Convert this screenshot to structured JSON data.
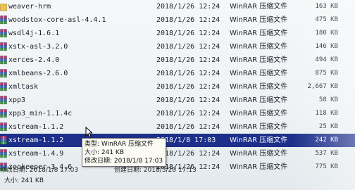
{
  "colors": {
    "selection": "#1c2f8a",
    "tooltip_bg": "#fbfbf4"
  },
  "files": [
    {
      "name": "weaver-hrm",
      "date": "2018/1/26 12:24",
      "type": "WinRAR 压缩文件",
      "size": "163 KB",
      "icon": "folder-icon"
    },
    {
      "name": "woodstox-core-asl-4.4.1",
      "date": "2018/1/26 12:24",
      "type": "WinRAR 压缩文件",
      "size": "475 KB",
      "icon": "winrar-archive-icon"
    },
    {
      "name": "wsdl4j-1.6.1",
      "date": "2018/1/26 12:24",
      "type": "WinRAR 压缩文件",
      "size": "180 KB",
      "icon": "winrar-archive-icon"
    },
    {
      "name": "xstx-asl-3.2.0",
      "date": "2018/1/26 12:24",
      "type": "WinRAR 压缩文件",
      "size": "146 KB",
      "icon": "winrar-archive-icon"
    },
    {
      "name": "xerces-2.4.0",
      "date": "2018/1/26 12:24",
      "type": "WinRAR 压缩文件",
      "size": "494 KB",
      "icon": "winrar-archive-icon"
    },
    {
      "name": "xmlbeans-2.6.0",
      "date": "2018/1/26 12:24",
      "type": "WinRAR 压缩文件",
      "size": "875 KB",
      "icon": "winrar-archive-icon"
    },
    {
      "name": "xmltask",
      "date": "2018/1/26 12:24",
      "type": "WinRAR 压缩文件",
      "size": "2,667 KB",
      "icon": "winrar-archive-icon"
    },
    {
      "name": "xpp3",
      "date": "2018/1/26 12:24",
      "type": "WinRAR 压缩文件",
      "size": "58 KB",
      "icon": "winrar-archive-icon"
    },
    {
      "name": "xpp3_min-1.1.4c",
      "date": "2018/1/26 12:24",
      "type": "WinRAR 压缩文件",
      "size": "118 KB",
      "icon": "winrar-archive-icon"
    },
    {
      "name": "xstream-1.1.2",
      "date": "2018/1/26 12:24",
      "type": "WinRAR 压缩文件",
      "size": "25 KB",
      "icon": "winrar-archive-icon"
    },
    {
      "name": "xstream-1.1.2",
      "date": "2018/1/8 17:03",
      "type": "WinRAR 压缩文件",
      "size": "242 KB",
      "icon": "winrar-archive-icon",
      "selected": true
    },
    {
      "name": "xstream-1.4.9",
      "date": "2018/1/26 12:24",
      "type": "WinRAR 压缩文件",
      "size": "537 KB",
      "icon": "winrar-archive-icon"
    },
    {
      "name": "zookeeper-3.4.6",
      "date": "2018/1/26 12:24",
      "type": "WinRAR 压缩文件",
      "size": "775 KB",
      "icon": "winrar-archive-icon"
    }
  ],
  "tooltip": {
    "type_line": "类型: WinRAR 压缩文件",
    "size_line": "大小: 241 KB",
    "modified_line": "修改日期: 2018/1/8 17:03"
  },
  "details": {
    "modified_text": "修改日期: 2018/1/8 17:03",
    "created_text": "创建日期: 2018/3/20 17:13",
    "size_text": "大小: 241 KB"
  }
}
